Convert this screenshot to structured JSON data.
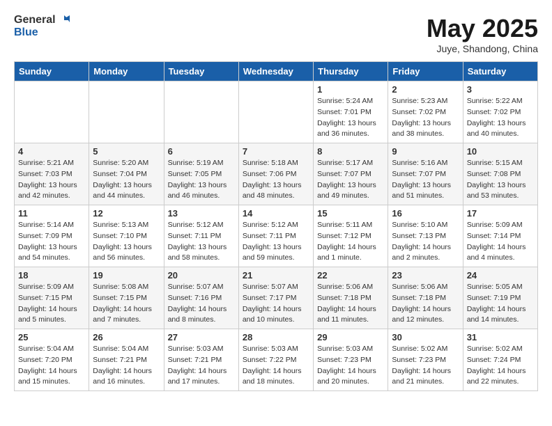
{
  "header": {
    "logo_general": "General",
    "logo_blue": "Blue",
    "month_title": "May 2025",
    "location": "Juye, Shandong, China"
  },
  "weekdays": [
    "Sunday",
    "Monday",
    "Tuesday",
    "Wednesday",
    "Thursday",
    "Friday",
    "Saturday"
  ],
  "weeks": [
    [
      {
        "day": "",
        "info": ""
      },
      {
        "day": "",
        "info": ""
      },
      {
        "day": "",
        "info": ""
      },
      {
        "day": "",
        "info": ""
      },
      {
        "day": "1",
        "info": "Sunrise: 5:24 AM\nSunset: 7:01 PM\nDaylight: 13 hours\nand 36 minutes."
      },
      {
        "day": "2",
        "info": "Sunrise: 5:23 AM\nSunset: 7:02 PM\nDaylight: 13 hours\nand 38 minutes."
      },
      {
        "day": "3",
        "info": "Sunrise: 5:22 AM\nSunset: 7:02 PM\nDaylight: 13 hours\nand 40 minutes."
      }
    ],
    [
      {
        "day": "4",
        "info": "Sunrise: 5:21 AM\nSunset: 7:03 PM\nDaylight: 13 hours\nand 42 minutes."
      },
      {
        "day": "5",
        "info": "Sunrise: 5:20 AM\nSunset: 7:04 PM\nDaylight: 13 hours\nand 44 minutes."
      },
      {
        "day": "6",
        "info": "Sunrise: 5:19 AM\nSunset: 7:05 PM\nDaylight: 13 hours\nand 46 minutes."
      },
      {
        "day": "7",
        "info": "Sunrise: 5:18 AM\nSunset: 7:06 PM\nDaylight: 13 hours\nand 48 minutes."
      },
      {
        "day": "8",
        "info": "Sunrise: 5:17 AM\nSunset: 7:07 PM\nDaylight: 13 hours\nand 49 minutes."
      },
      {
        "day": "9",
        "info": "Sunrise: 5:16 AM\nSunset: 7:07 PM\nDaylight: 13 hours\nand 51 minutes."
      },
      {
        "day": "10",
        "info": "Sunrise: 5:15 AM\nSunset: 7:08 PM\nDaylight: 13 hours\nand 53 minutes."
      }
    ],
    [
      {
        "day": "11",
        "info": "Sunrise: 5:14 AM\nSunset: 7:09 PM\nDaylight: 13 hours\nand 54 minutes."
      },
      {
        "day": "12",
        "info": "Sunrise: 5:13 AM\nSunset: 7:10 PM\nDaylight: 13 hours\nand 56 minutes."
      },
      {
        "day": "13",
        "info": "Sunrise: 5:12 AM\nSunset: 7:11 PM\nDaylight: 13 hours\nand 58 minutes."
      },
      {
        "day": "14",
        "info": "Sunrise: 5:12 AM\nSunset: 7:11 PM\nDaylight: 13 hours\nand 59 minutes."
      },
      {
        "day": "15",
        "info": "Sunrise: 5:11 AM\nSunset: 7:12 PM\nDaylight: 14 hours\nand 1 minute."
      },
      {
        "day": "16",
        "info": "Sunrise: 5:10 AM\nSunset: 7:13 PM\nDaylight: 14 hours\nand 2 minutes."
      },
      {
        "day": "17",
        "info": "Sunrise: 5:09 AM\nSunset: 7:14 PM\nDaylight: 14 hours\nand 4 minutes."
      }
    ],
    [
      {
        "day": "18",
        "info": "Sunrise: 5:09 AM\nSunset: 7:15 PM\nDaylight: 14 hours\nand 5 minutes."
      },
      {
        "day": "19",
        "info": "Sunrise: 5:08 AM\nSunset: 7:15 PM\nDaylight: 14 hours\nand 7 minutes."
      },
      {
        "day": "20",
        "info": "Sunrise: 5:07 AM\nSunset: 7:16 PM\nDaylight: 14 hours\nand 8 minutes."
      },
      {
        "day": "21",
        "info": "Sunrise: 5:07 AM\nSunset: 7:17 PM\nDaylight: 14 hours\nand 10 minutes."
      },
      {
        "day": "22",
        "info": "Sunrise: 5:06 AM\nSunset: 7:18 PM\nDaylight: 14 hours\nand 11 minutes."
      },
      {
        "day": "23",
        "info": "Sunrise: 5:06 AM\nSunset: 7:18 PM\nDaylight: 14 hours\nand 12 minutes."
      },
      {
        "day": "24",
        "info": "Sunrise: 5:05 AM\nSunset: 7:19 PM\nDaylight: 14 hours\nand 14 minutes."
      }
    ],
    [
      {
        "day": "25",
        "info": "Sunrise: 5:04 AM\nSunset: 7:20 PM\nDaylight: 14 hours\nand 15 minutes."
      },
      {
        "day": "26",
        "info": "Sunrise: 5:04 AM\nSunset: 7:21 PM\nDaylight: 14 hours\nand 16 minutes."
      },
      {
        "day": "27",
        "info": "Sunrise: 5:03 AM\nSunset: 7:21 PM\nDaylight: 14 hours\nand 17 minutes."
      },
      {
        "day": "28",
        "info": "Sunrise: 5:03 AM\nSunset: 7:22 PM\nDaylight: 14 hours\nand 18 minutes."
      },
      {
        "day": "29",
        "info": "Sunrise: 5:03 AM\nSunset: 7:23 PM\nDaylight: 14 hours\nand 20 minutes."
      },
      {
        "day": "30",
        "info": "Sunrise: 5:02 AM\nSunset: 7:23 PM\nDaylight: 14 hours\nand 21 minutes."
      },
      {
        "day": "31",
        "info": "Sunrise: 5:02 AM\nSunset: 7:24 PM\nDaylight: 14 hours\nand 22 minutes."
      }
    ]
  ]
}
